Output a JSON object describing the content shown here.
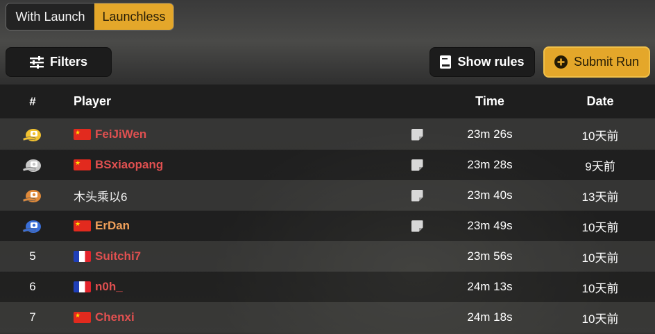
{
  "tabs": [
    {
      "label": "With Launch",
      "active": false
    },
    {
      "label": "Launchless",
      "active": true
    }
  ],
  "toolbar": {
    "filters_label": "Filters",
    "filters_icon": "sliders-icon",
    "rules_label": "Show rules",
    "rules_icon": "book-icon",
    "submit_label": "Submit Run",
    "submit_icon": "plus-circle-icon"
  },
  "colors": {
    "accent": "#e4a72a",
    "player_name": "#e05050",
    "player_name_alt": "#f0a05a",
    "gold": "#f2c230",
    "silver": "#c8c8c8",
    "bronze": "#e08a3a",
    "fourth": "#3a6fd8"
  },
  "table": {
    "headers": {
      "rank": "#",
      "player": "Player",
      "time": "Time",
      "date": "Date"
    },
    "rows": [
      {
        "rank": "",
        "rank_icon": "gold-cap-icon",
        "flag": "cn",
        "player": "FeiJiWen",
        "name_style": "red",
        "note": true,
        "time": "23m 26s",
        "date": "10天前"
      },
      {
        "rank": "",
        "rank_icon": "silver-cap-icon",
        "flag": "cn",
        "player": "BSxiaopang",
        "name_style": "red",
        "note": true,
        "time": "23m 28s",
        "date": "9天前"
      },
      {
        "rank": "",
        "rank_icon": "bronze-cap-icon",
        "flag": "",
        "player": "木头乘以6",
        "name_style": "plain",
        "note": true,
        "time": "23m 40s",
        "date": "13天前"
      },
      {
        "rank": "",
        "rank_icon": "blue-cap-icon",
        "flag": "cn",
        "player": "ErDan",
        "name_style": "orange",
        "note": true,
        "time": "23m 49s",
        "date": "10天前"
      },
      {
        "rank": "5",
        "rank_icon": "",
        "flag": "fr",
        "player": "Suitchi7",
        "name_style": "red",
        "note": false,
        "time": "23m 56s",
        "date": "10天前"
      },
      {
        "rank": "6",
        "rank_icon": "",
        "flag": "fr",
        "player": "n0h_",
        "name_style": "red",
        "note": false,
        "time": "24m 13s",
        "date": "10天前"
      },
      {
        "rank": "7",
        "rank_icon": "",
        "flag": "cn",
        "player": "Chenxi",
        "name_style": "red",
        "note": false,
        "time": "24m 18s",
        "date": "10天前"
      }
    ]
  }
}
